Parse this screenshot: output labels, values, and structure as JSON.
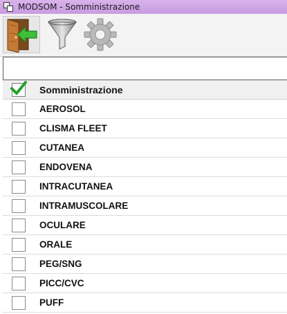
{
  "window": {
    "title": "MODSOM - Somministrazione"
  },
  "toolbar": {
    "buttons": [
      {
        "icon": "exit-door-icon"
      },
      {
        "icon": "funnel-filter-icon"
      },
      {
        "icon": "gear-icon"
      }
    ]
  },
  "filter": {
    "value": "",
    "placeholder": ""
  },
  "grid": {
    "header": {
      "column_label": "Somministrazione",
      "select_all_checked": true
    },
    "rows": [
      {
        "label": "AEROSOL",
        "checked": false
      },
      {
        "label": "CLISMA FLEET",
        "checked": false
      },
      {
        "label": "CUTANEA",
        "checked": false
      },
      {
        "label": "ENDOVENA",
        "checked": false
      },
      {
        "label": "INTRACUTANEA",
        "checked": false
      },
      {
        "label": "INTRAMUSCOLARE",
        "checked": false
      },
      {
        "label": "OCULARE",
        "checked": false
      },
      {
        "label": "ORALE",
        "checked": false
      },
      {
        "label": "PEG/SNG",
        "checked": false
      },
      {
        "label": "PICC/CVC",
        "checked": false
      },
      {
        "label": "PUFF",
        "checked": false
      }
    ]
  },
  "colors": {
    "titlebar": "#c99be0",
    "check_green": "#22a02a",
    "door_wood": "#b86a2c",
    "arrow_green": "#3fbf3a"
  }
}
